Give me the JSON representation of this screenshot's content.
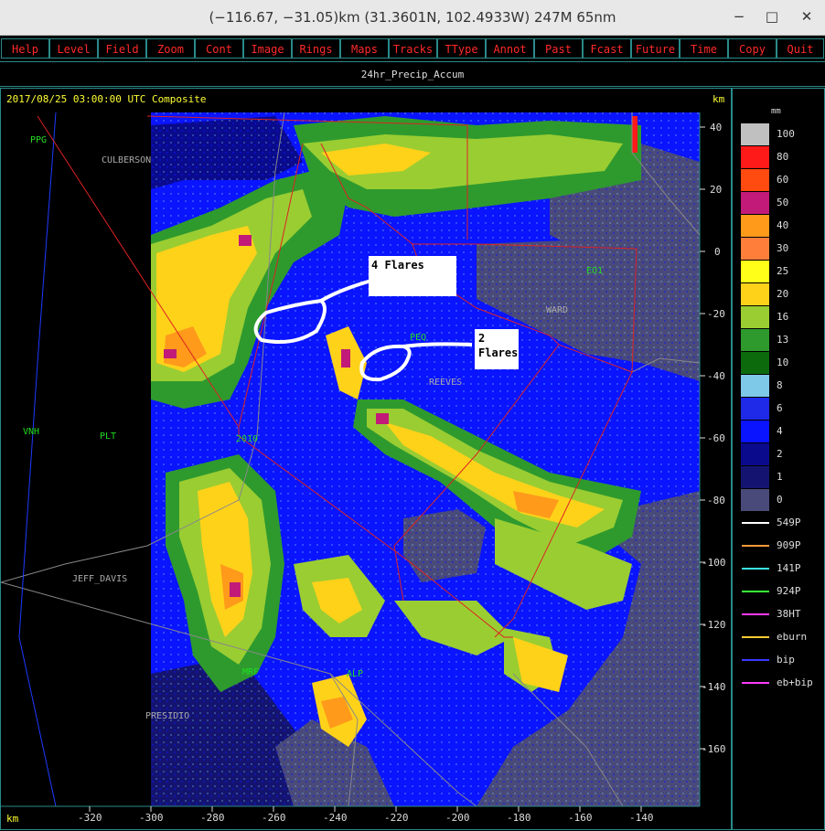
{
  "window": {
    "title": "(−116.67, −31.05)km (31.3601N, 102.4933W) 247M 65nm",
    "minimize_glyph": "−",
    "maximize_glyph": "□",
    "close_glyph": "✕"
  },
  "menu": [
    "Help",
    "Level",
    "Field",
    "Zoom",
    "Cont",
    "Image",
    "Rings",
    "Maps",
    "Tracks",
    "TType",
    "Annot",
    "Past",
    "Fcast",
    "Future",
    "Time",
    "Copy",
    "Quit"
  ],
  "field_title": "24hr_Precip_Accum",
  "map": {
    "timestamp": "2017/08/25 03:00:00 UTC Composite",
    "km_unit_top": "km",
    "km_unit_bottom": "km",
    "y_ticks": [
      "40",
      "20",
      "0",
      "-20",
      "-40",
      "-60",
      "-80",
      "-100",
      "-120",
      "-140",
      "-160"
    ],
    "x_ticks": [
      "-320",
      "-300",
      "-280",
      "-260",
      "-240",
      "-220",
      "-200",
      "-180",
      "-160",
      "-140"
    ],
    "stations": [
      {
        "id": "stn-ppg",
        "text": "PPG",
        "color": "#22dd22"
      },
      {
        "id": "stn-eo1",
        "text": "EO1",
        "color": "#22dd22"
      },
      {
        "id": "stn-peq",
        "text": "PEQ",
        "color": "#22dd22"
      },
      {
        "id": "stn-vnh",
        "text": "VNH",
        "color": "#22dd22"
      },
      {
        "id": "stn-plt",
        "text": "PLT",
        "color": "#22dd22"
      },
      {
        "id": "stn-2010",
        "text": "2010",
        "color": "#22dd22"
      },
      {
        "id": "stn-alp",
        "text": "ALP",
        "color": "#22dd22"
      },
      {
        "id": "stn-mrf",
        "text": "MRF",
        "color": "#22dd22"
      }
    ],
    "counties": [
      {
        "id": "county-culberson",
        "text": "CULBERSON"
      },
      {
        "id": "county-ward",
        "text": "WARD"
      },
      {
        "id": "county-reeves",
        "text": "REEVES"
      },
      {
        "id": "county-jeff-davis",
        "text": "JEFF_DAVIS"
      },
      {
        "id": "county-presidio",
        "text": "PRESIDIO"
      }
    ],
    "annotations": [
      {
        "id": "annot-4-flares",
        "lines": [
          "4 Flares"
        ]
      },
      {
        "id": "annot-2-flares",
        "lines": [
          "2",
          "Flares"
        ]
      }
    ]
  },
  "legend": {
    "unit": "mm",
    "bins": [
      {
        "label": "100",
        "color": "#c0c0c0"
      },
      {
        "label": "80",
        "color": "#ff1a1a"
      },
      {
        "label": "60",
        "color": "#ff4a10"
      },
      {
        "label": "50",
        "color": "#c21a78"
      },
      {
        "label": "40",
        "color": "#ff9a1a"
      },
      {
        "label": "30",
        "color": "#ff7f3a"
      },
      {
        "label": "25",
        "color": "#ffff1a"
      },
      {
        "label": "20",
        "color": "#ffd21a"
      },
      {
        "label": "16",
        "color": "#9acd32"
      },
      {
        "label": "13",
        "color": "#2e9a2e"
      },
      {
        "label": "10",
        "color": "#0c6a0c"
      },
      {
        "label": "8",
        "color": "#7ec8e8"
      },
      {
        "label": "6",
        "color": "#1e2ae8"
      },
      {
        "label": "4",
        "color": "#0a14ff"
      },
      {
        "label": "2",
        "color": "#0a0a8c"
      },
      {
        "label": "1",
        "color": "#141470"
      },
      {
        "label": "0",
        "color": "#4a4a7a"
      }
    ],
    "tracks": [
      {
        "label": "549P",
        "color": "#ffffff"
      },
      {
        "label": "909P",
        "color": "#ff9a3a"
      },
      {
        "label": "141P",
        "color": "#3ae8e8"
      },
      {
        "label": "924P",
        "color": "#3aff3a"
      },
      {
        "label": "38HT",
        "color": "#ff3aff"
      },
      {
        "label": "eburn",
        "color": "#ffcc33"
      },
      {
        "label": "bip",
        "color": "#3a3aff"
      },
      {
        "label": "eb+bip",
        "color": "#ff3aff"
      }
    ]
  }
}
